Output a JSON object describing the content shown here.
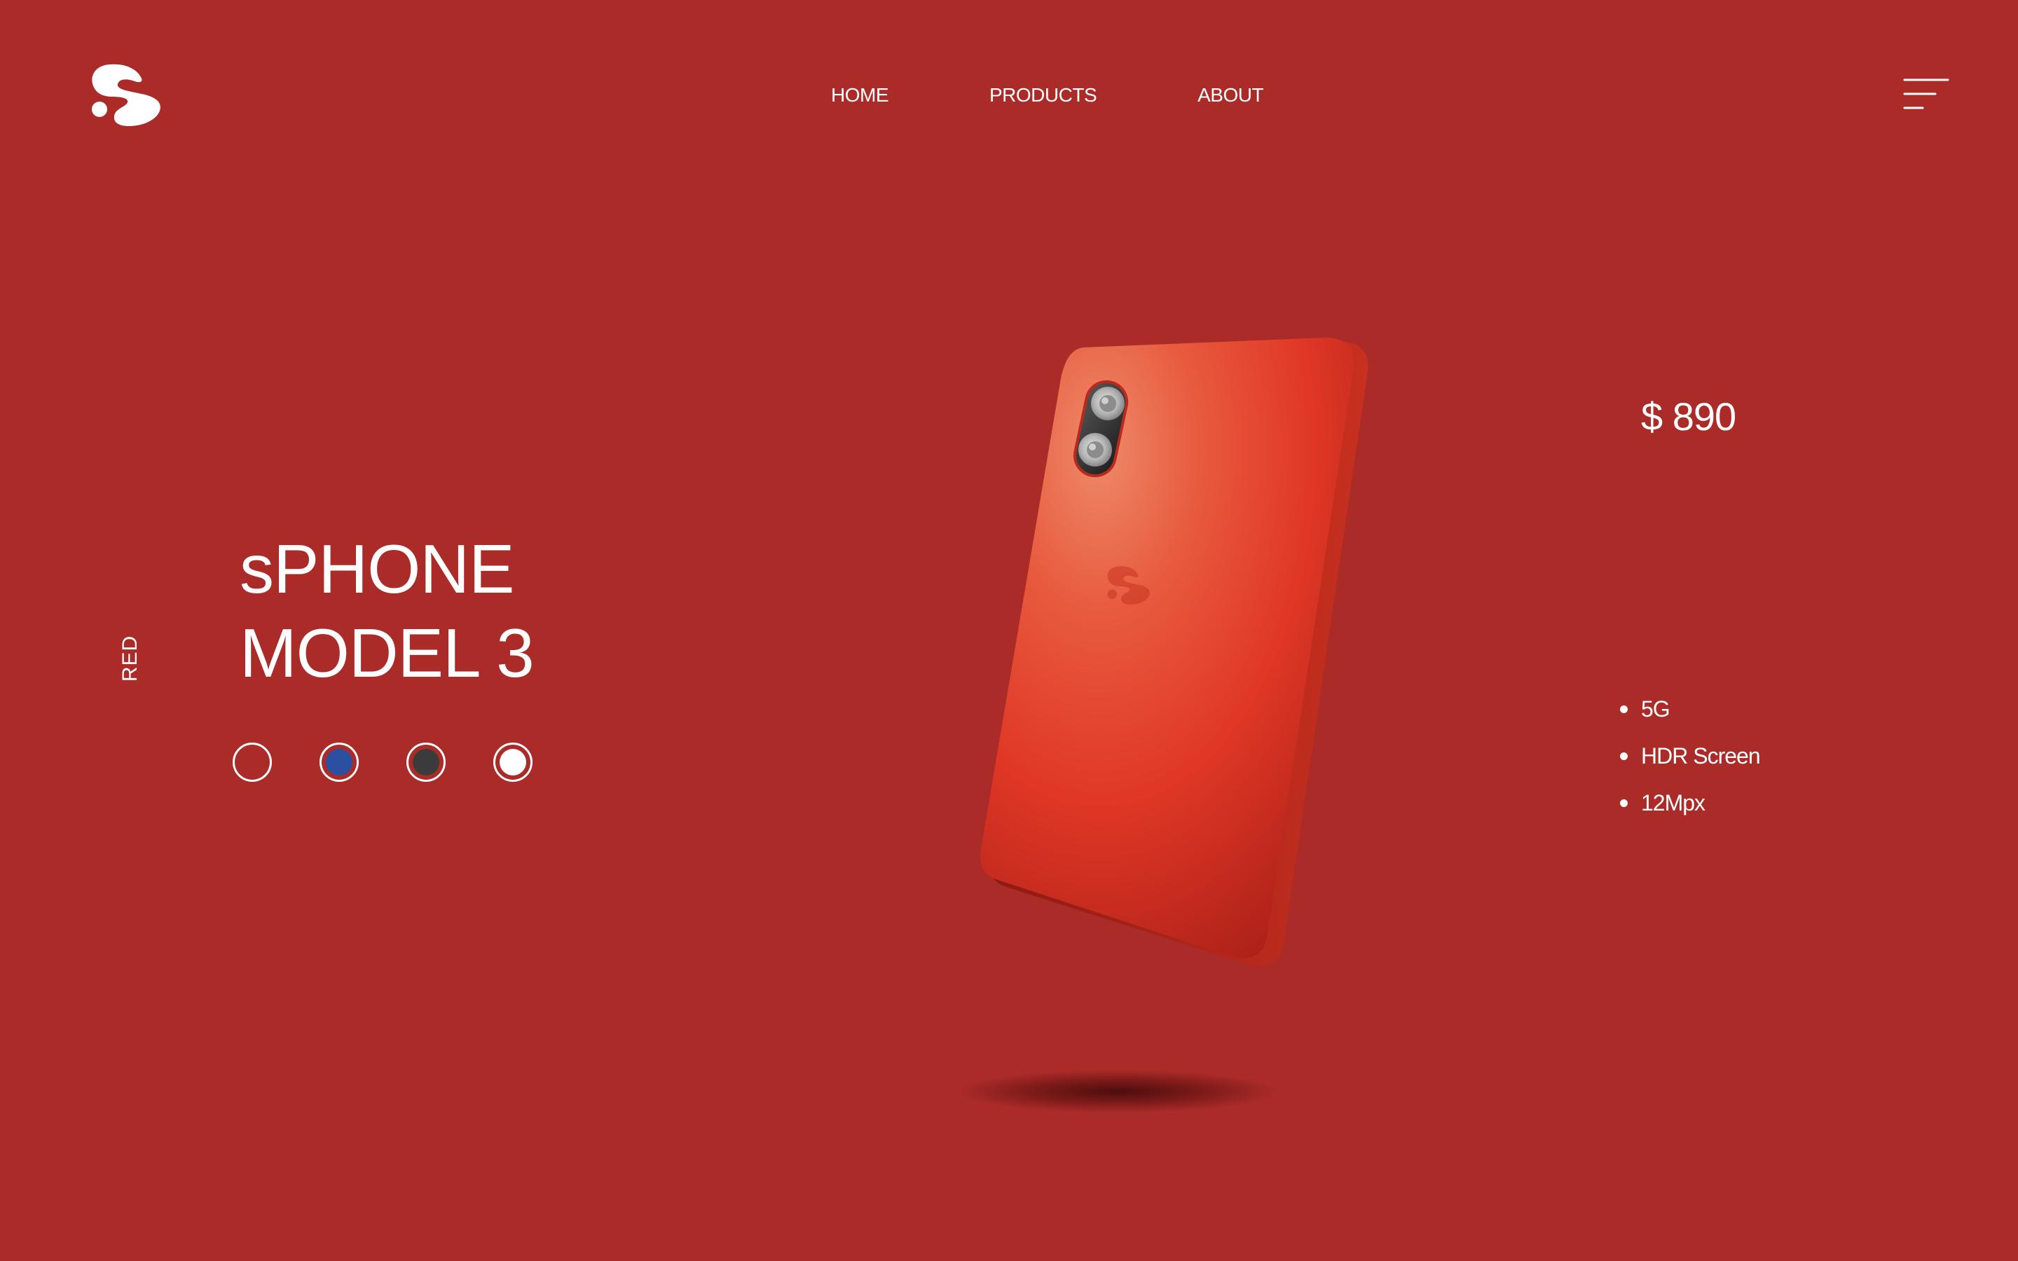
{
  "header": {
    "logo": {
      "icon": "s-logo-icon"
    },
    "nav": {
      "items": [
        {
          "label": "HOME"
        },
        {
          "label": "PRODUCTS"
        },
        {
          "label": "ABOUT"
        }
      ]
    },
    "menu": {
      "icon": "hamburger-menu-icon"
    }
  },
  "product": {
    "color_label": "RED",
    "title_line1": "sPHONE",
    "title_line2": "MODEL 3",
    "price": "$ 890",
    "swatches": [
      {
        "color": "#AB2B28",
        "name": "red"
      },
      {
        "color": "#2A4FA3",
        "name": "blue"
      },
      {
        "color": "#3B3B3B",
        "name": "dark-gray"
      },
      {
        "color": "#FFFFFF",
        "name": "white"
      }
    ],
    "features": [
      {
        "label": "5G"
      },
      {
        "label": "HDR Screen"
      },
      {
        "label": "12Mpx"
      }
    ]
  },
  "colors": {
    "background": "#AB2B28",
    "text": "#FFFFFF",
    "phone_body": "#E23A29"
  }
}
